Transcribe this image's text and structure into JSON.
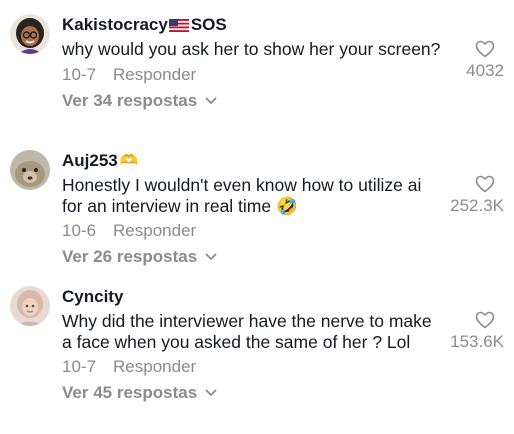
{
  "comments": [
    {
      "username": "Kakistocracy",
      "username_suffix": "SOS",
      "text": "why would you ask her to show her your screen?",
      "date": "10-7",
      "reply_label": "Responder",
      "more_label": "Ver 34 respostas",
      "likes": "4032"
    },
    {
      "username": "Auj253",
      "username_emoji": "🫶",
      "text": "Honestly I wouldn't even know how to utilize ai for an interview in real time 🤣",
      "date": "10-6",
      "reply_label": "Responder",
      "more_label": "Ver 26 respostas",
      "likes": "252.3K"
    },
    {
      "username": "Cyncity",
      "text": "Why did the interviewer have the nerve to make a face when you asked the same of her ? Lol",
      "date": "10-7",
      "reply_label": "Responder",
      "more_label": "Ver 45 respostas",
      "likes": "153.6K"
    }
  ],
  "icons": {
    "like": "heart-outline-icon",
    "expand": "chevron-down-icon",
    "flag": "us-flag-icon"
  }
}
